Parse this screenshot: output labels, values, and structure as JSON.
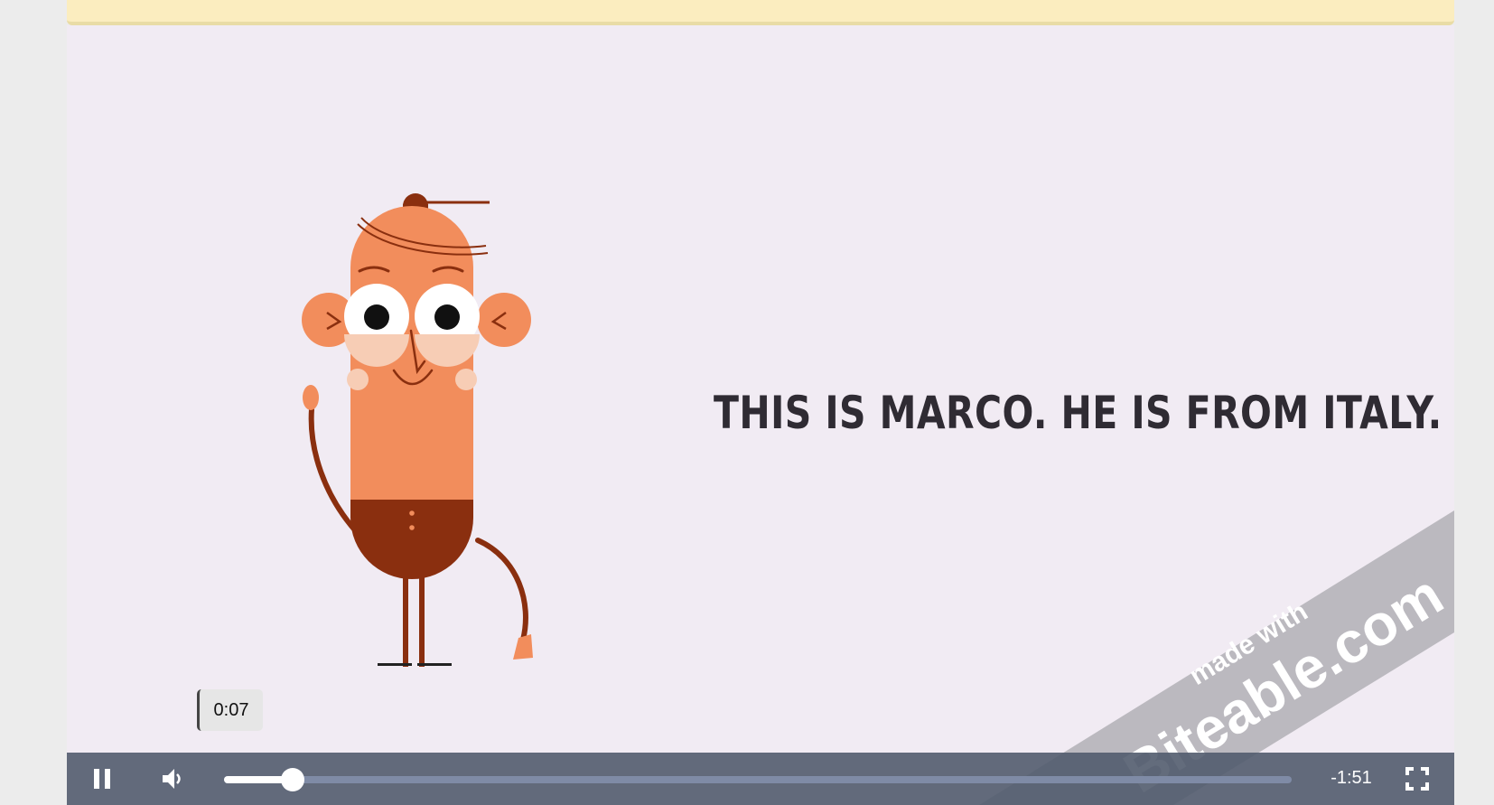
{
  "video": {
    "caption": "THIS IS MARCO. HE IS FROM ITALY.",
    "watermark_line1": "made with",
    "watermark_line2": "Biteable.com"
  },
  "controls": {
    "play_state": "pause-icon",
    "volume_icon": "volume-icon",
    "fullscreen_icon": "fullscreen-icon",
    "hover_time": "0:07",
    "remaining_time": "-1:51",
    "progress_fraction": 0.064
  },
  "colors": {
    "skin": "#f28d5c",
    "hair": "#8a2f0f",
    "caption": "#2f2b33",
    "background": "#f1ebf3",
    "controls_bar": "#525c6e"
  }
}
